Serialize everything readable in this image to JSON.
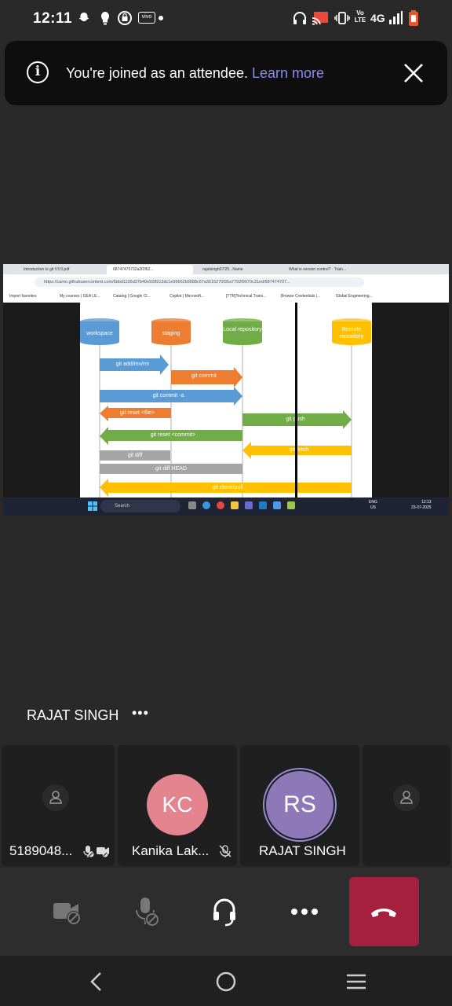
{
  "status_bar": {
    "time": "12:11",
    "network_label": "4G",
    "volte_label": "Vo LTE",
    "icons": [
      "snapchat-icon",
      "notification-icon",
      "bag-icon",
      "vivo-icon",
      "dot-icon",
      "headphones-icon",
      "cast-icon",
      "vibrate-icon",
      "signal-icon",
      "battery-icon"
    ]
  },
  "banner": {
    "message": "You're joined as an attendee.",
    "link": "Learn more",
    "info_icon": "info-icon",
    "close_icon": "close-icon"
  },
  "shared_screen": {
    "tabs": [
      "Introduction to git V3.0.pdf",
      "68747470732a2f2f62...",
      "rajatsingh07/25...Name",
      "What is version control? · Train..."
    ],
    "url": "https://camo.githubusercontent.com/6bbd1195d37b40e928913dc1e95662b9688c67a3615270f35a7792f9970c31ed/687474707...",
    "favorites": [
      "Import favorites",
      "My courses | GEA LE...",
      "Catalog | Google Cl...",
      "Copilot | Microsoft...",
      "[TTR]Technical Traini...",
      "Browse Credentials |...",
      "Global Engineering..."
    ],
    "taskbar": {
      "search": "Search",
      "lang_top": "ENG",
      "lang_bottom": "US",
      "time": "12:13",
      "date": "23-07-2025"
    },
    "diagram": {
      "stores": [
        "workspace",
        "staging",
        "Local repository",
        "Remote repository"
      ],
      "commands": [
        "git add/mv/rm",
        "git commit",
        "git commit -a",
        "git reset <file>",
        "git push",
        "git reset <commit>",
        "git fetch",
        "git diff",
        "git diff HEAD",
        "git clone/pull"
      ],
      "colors": {
        "blue": "#5b9bd5",
        "orange": "#ed7d31",
        "green": "#70ad47",
        "yellow": "#ffc000",
        "gray": "#a5a5a5"
      }
    }
  },
  "presenter": {
    "name": "RAJAT SINGH",
    "more": "•••"
  },
  "participants": [
    {
      "name": "5189048...",
      "avatar": "person-icon",
      "status_icons": [
        "mic-off-icon",
        "video-off-icon"
      ]
    },
    {
      "name": "Kanika Lak...",
      "initials": "KC",
      "color": "#e4848f",
      "status_icons": [
        "mic-off-icon"
      ]
    },
    {
      "name": "RAJAT SINGH",
      "initials": "RS",
      "color": "#8e78b8",
      "active": true
    },
    {
      "name": "",
      "avatar": "person-icon"
    }
  ],
  "controls": [
    "video-off-button",
    "mic-off-button",
    "audio-button",
    "more-button",
    "hang-up-button"
  ],
  "nav": [
    "back-button",
    "home-button",
    "recents-button"
  ]
}
